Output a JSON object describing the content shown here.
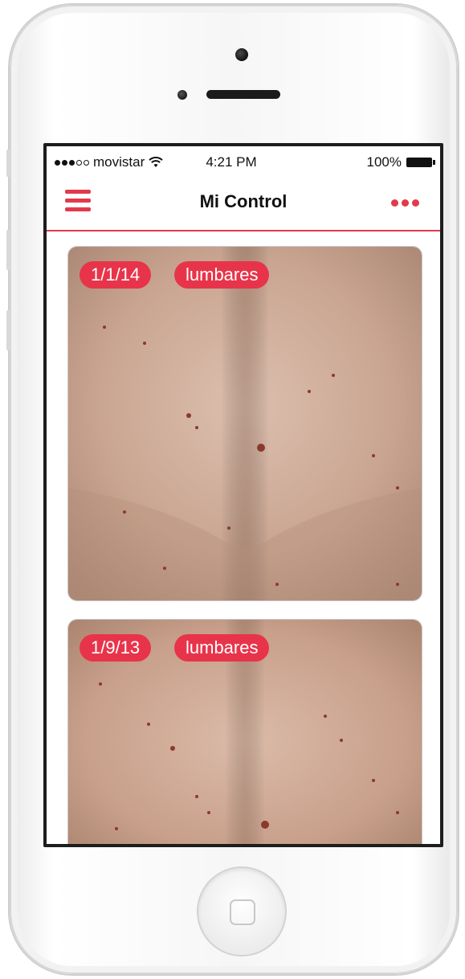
{
  "status_bar": {
    "carrier": "movistar",
    "time": "4:21 PM",
    "battery": "100%"
  },
  "navbar": {
    "title": "Mi Control",
    "menu_icon": "hamburger-menu-icon",
    "more_icon": "more-dots-icon"
  },
  "entries": [
    {
      "date": "1/1/14",
      "area": "lumbares"
    },
    {
      "date": "1/9/13",
      "area": "lumbares"
    }
  ],
  "colors": {
    "accent": "#e23a4c",
    "tag_bg": "#e8344a"
  }
}
